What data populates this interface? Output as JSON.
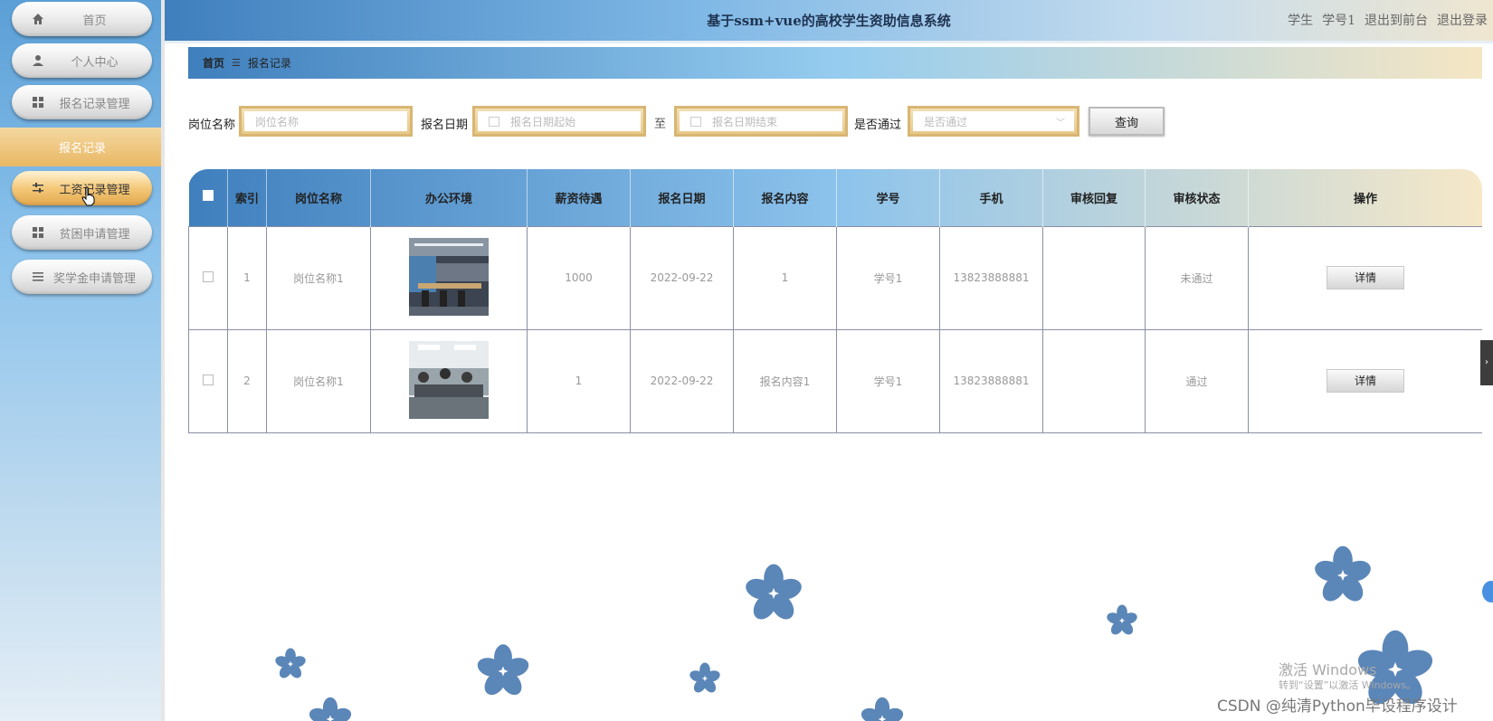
{
  "app": {
    "title": "基于ssm+vue的高校学生资助信息系统"
  },
  "user": {
    "role": "学生",
    "name": "学号1",
    "back_front": "退出到前台",
    "logout": "退出登录"
  },
  "sidebar": {
    "items": [
      {
        "label": "首页",
        "icon": "home-icon"
      },
      {
        "label": "个人中心",
        "icon": "user-icon"
      },
      {
        "label": "报名记录管理",
        "icon": "grid-icon"
      },
      {
        "label": "工资记录管理",
        "icon": "sliders-icon"
      },
      {
        "label": "贫困申请管理",
        "icon": "grid-icon"
      },
      {
        "label": "奖学金申请管理",
        "icon": "list-icon"
      }
    ],
    "submenu": "报名记录"
  },
  "breadcrumb": {
    "home": "首页",
    "current": "报名记录"
  },
  "search": {
    "position_label": "岗位名称",
    "position_placeholder": "岗位名称",
    "date_label": "报名日期",
    "date_start_placeholder": "报名日期起始",
    "to": "至",
    "date_end_placeholder": "报名日期结束",
    "pass_label": "是否通过",
    "pass_placeholder": "是否通过",
    "query_button": "查询"
  },
  "table": {
    "headers": [
      "索引",
      "岗位名称",
      "办公环境",
      "薪资待遇",
      "报名日期",
      "报名内容",
      "学号",
      "手机",
      "审核回复",
      "审核状态",
      "操作"
    ],
    "rows": [
      {
        "index": "1",
        "position": "岗位名称1",
        "salary": "1000",
        "date": "2022-09-22",
        "content": "1",
        "student_id": "学号1",
        "phone": "13823888881",
        "reply": "",
        "status": "未通过",
        "action": "详情"
      },
      {
        "index": "2",
        "position": "岗位名称1",
        "salary": "1",
        "date": "2022-09-22",
        "content": "报名内容1",
        "student_id": "学号1",
        "phone": "13823888881",
        "reply": "",
        "status": "通过",
        "action": "详情"
      }
    ]
  },
  "watermark": {
    "line1": "激活 Windows",
    "line2": "转到“设置”以激活 Windows。",
    "csdn": "CSDN @纯清Python毕设程序设计"
  },
  "colors": {
    "accent_blue": "#3f7fbd",
    "accent_gold": "#e9b865",
    "flower": "#5b86b8"
  }
}
